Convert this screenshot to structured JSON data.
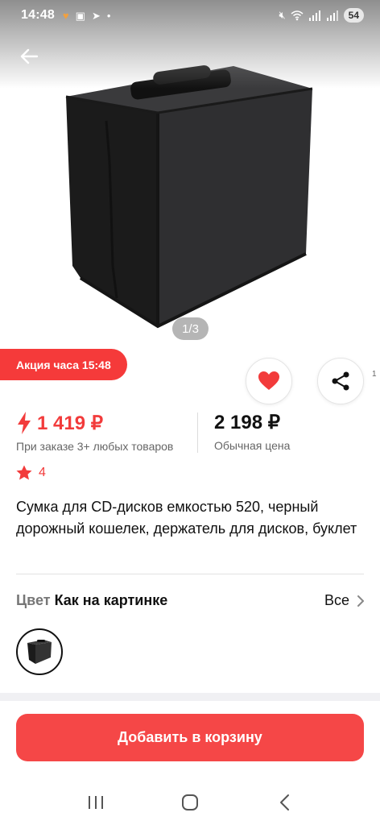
{
  "status": {
    "time": "14:48",
    "battery": "54"
  },
  "gallery": {
    "pager": "1/3"
  },
  "promo": {
    "label": "Акция часа 15:48"
  },
  "edge_number": "1",
  "price": {
    "promo_value": "1 419 ₽",
    "promo_note": "При заказе 3+ любых товаров",
    "regular_value": "2 198 ₽",
    "regular_label": "Обычная цена"
  },
  "rating": {
    "value": "4"
  },
  "product": {
    "title": "Сумка для CD-дисков емкостью 520, черный дорожный кошелек, держатель для дисков, буклет"
  },
  "color": {
    "label": "Цвет",
    "value": "Как на картинке",
    "all_label": "Все"
  },
  "cart": {
    "button_label": "Добавить в корзину"
  },
  "colors": {
    "accent": "#f23b3b",
    "cart_button": "#f54747",
    "promo_badge": "#f53a3a"
  },
  "icons": [
    "back-arrow-icon",
    "heart-icon",
    "share-icon",
    "lightning-icon",
    "star-icon",
    "chevron-right-icon",
    "recent-apps-icon",
    "home-icon",
    "back-nav-icon"
  ]
}
